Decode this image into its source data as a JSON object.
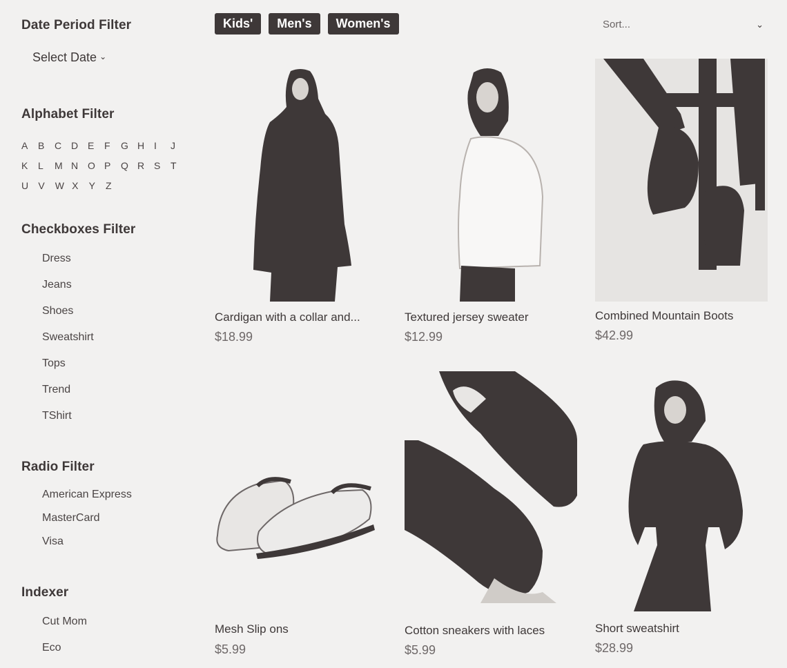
{
  "sidebar": {
    "date_filter": {
      "title": "Date Period Filter",
      "select_label": "Select Date"
    },
    "alphabet_filter": {
      "title": "Alphabet Filter",
      "rows": [
        [
          "A",
          "B",
          "C",
          "D",
          "E",
          "F",
          "G",
          "H",
          "I",
          "J"
        ],
        [
          "K",
          "L",
          "M",
          "N",
          "O",
          "P",
          "Q",
          "R",
          "S",
          "T"
        ],
        [
          "U",
          "V",
          "W",
          "X",
          "Y",
          "Z"
        ]
      ]
    },
    "checkboxes_filter": {
      "title": "Checkboxes Filter",
      "items": [
        "Dress",
        "Jeans",
        "Shoes",
        "Sweatshirt",
        "Tops",
        "Trend",
        "TShirt"
      ]
    },
    "radio_filter": {
      "title": "Radio Filter",
      "items": [
        "American Express",
        "MasterCard",
        "Visa"
      ]
    },
    "indexer": {
      "title": "Indexer",
      "items": [
        "Cut Mom",
        "Eco"
      ]
    }
  },
  "tabs": [
    "Kids'",
    "Men's",
    "Women's"
  ],
  "sort": {
    "label": "Sort..."
  },
  "products": [
    {
      "name": "Cardigan with a collar and...",
      "price": "$18.99"
    },
    {
      "name": "Textured jersey sweater",
      "price": "$12.99"
    },
    {
      "name": "Combined Mountain Boots",
      "price": "$42.99"
    },
    {
      "name": "Mesh Slip ons",
      "price": "$5.99"
    },
    {
      "name": "Cotton sneakers with laces",
      "price": "$5.99"
    },
    {
      "name": "Short sweatshirt",
      "price": "$28.99"
    }
  ],
  "colors": {
    "dark": "#3e3838",
    "background": "#f2f1f0"
  }
}
